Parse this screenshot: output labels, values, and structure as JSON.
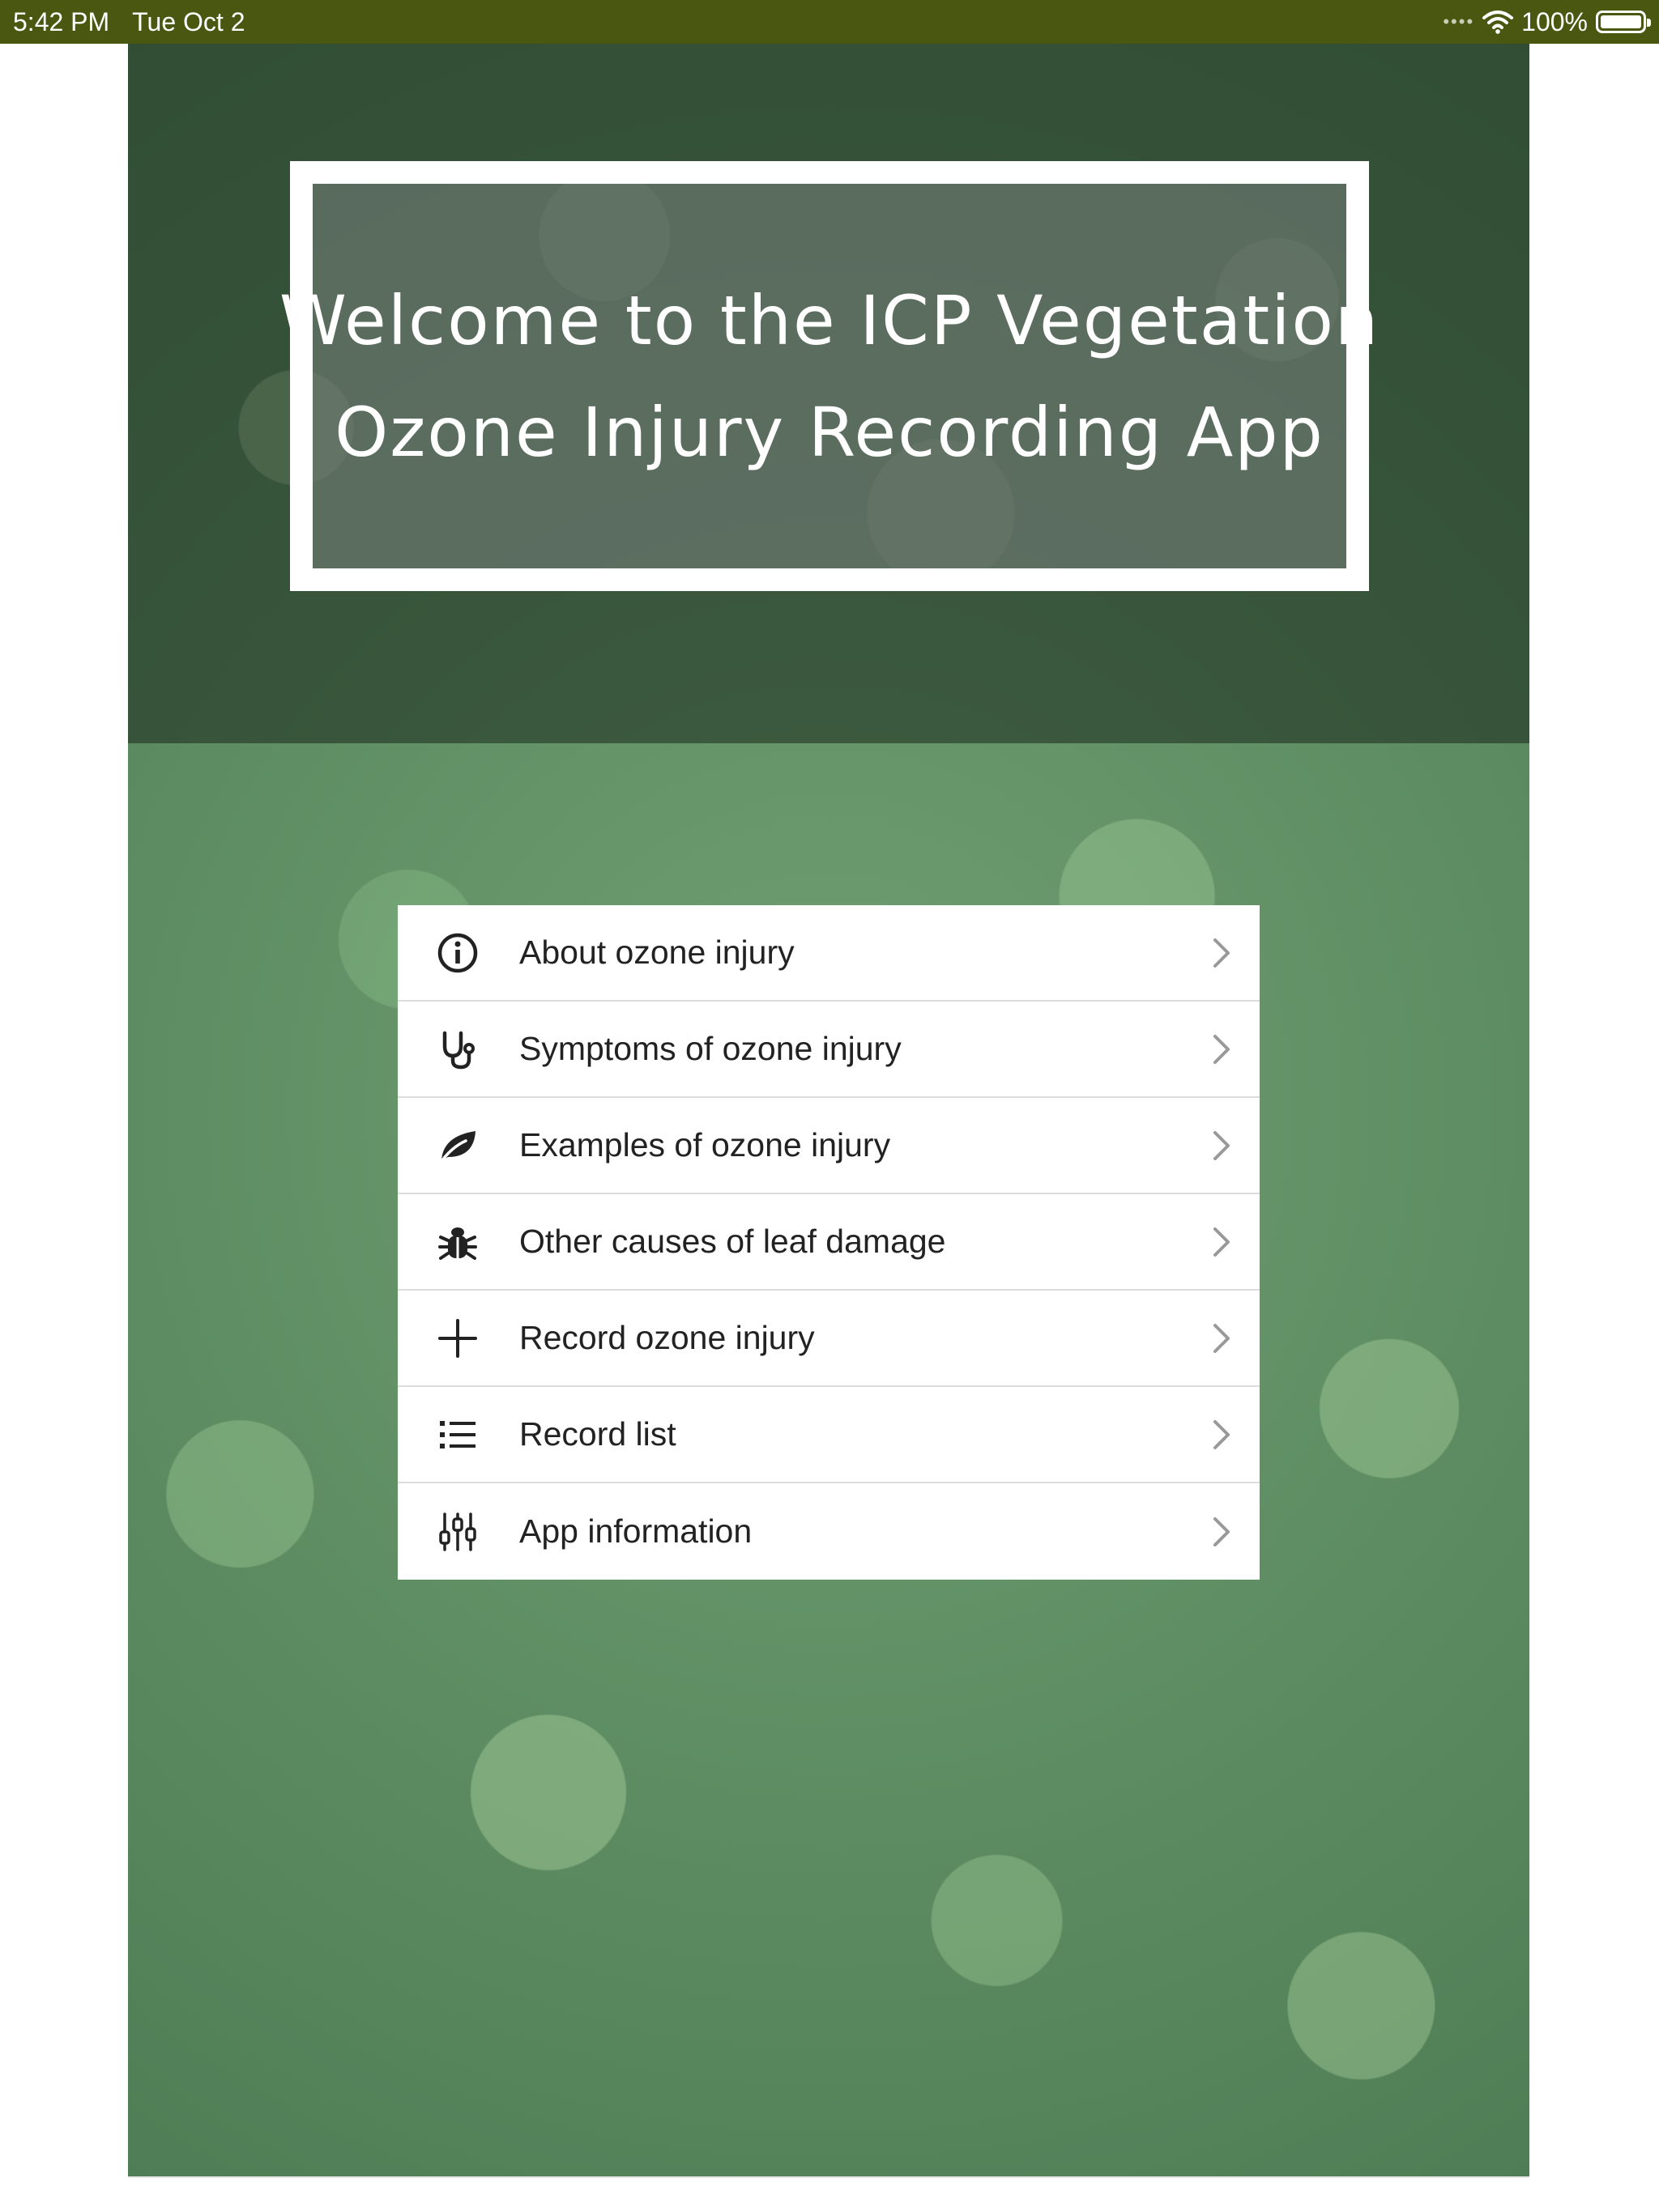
{
  "status_bar": {
    "time": "5:42 PM",
    "date": "Tue Oct 2",
    "battery": "100%",
    "battery_level": 1.0
  },
  "header": {
    "title_line1": "Welcome to the ICP Vegetation",
    "title_line2": "Ozone Injury Recording App"
  },
  "menu": {
    "items": [
      {
        "label": "About ozone injury",
        "icon": "info-circle-icon"
      },
      {
        "label": "Symptoms of ozone injury",
        "icon": "stethoscope-icon"
      },
      {
        "label": "Examples of ozone injury",
        "icon": "leaf-icon"
      },
      {
        "label": "Other causes of leaf damage",
        "icon": "bug-icon"
      },
      {
        "label": "Record ozone injury",
        "icon": "plus-icon"
      },
      {
        "label": "Record list",
        "icon": "list-icon"
      },
      {
        "label": "App information",
        "icon": "sliders-icon"
      }
    ]
  },
  "colors": {
    "status_bar": "#4a5710",
    "menu_background": "#ffffff",
    "menu_text": "#222222",
    "divider": "#dcdcdc",
    "chevron": "#999999"
  }
}
